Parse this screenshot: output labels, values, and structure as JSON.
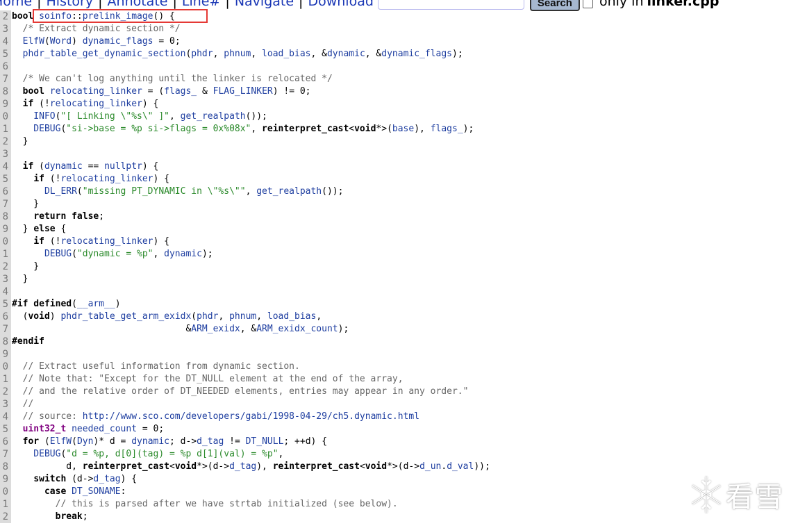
{
  "nav": {
    "links": [
      "Home",
      "History",
      "Annotate",
      "Line#",
      "Navigate",
      "Download"
    ],
    "search_value": "",
    "search_button": "Search",
    "only_in_label": "only in",
    "only_in_file": "linker.cpp",
    "only_in_checked": false
  },
  "highlight": {
    "color": "#e53935",
    "target": "soinfo::prelink_image() {"
  },
  "code_lines": [
    {
      "n": "2",
      "tokens": [
        [
          "k",
          "bool"
        ],
        [
          "",
          ""
        ],
        [
          "i",
          " soinfo"
        ],
        [
          "",
          "::"
        ],
        [
          "i",
          "prelink_image"
        ],
        [
          "",
          "() {"
        ]
      ]
    },
    {
      "n": "3",
      "tokens": [
        [
          "c",
          "  /* Extract dynamic section */"
        ]
      ]
    },
    {
      "n": "4",
      "tokens": [
        [
          "i",
          "  ElfW"
        ],
        [
          "",
          "("
        ],
        [
          "i",
          "Word"
        ],
        [
          "",
          ") "
        ],
        [
          "i",
          "dynamic_flags"
        ],
        [
          "",
          " = 0;"
        ]
      ]
    },
    {
      "n": "5",
      "tokens": [
        [
          "i",
          "  phdr_table_get_dynamic_section"
        ],
        [
          "",
          "("
        ],
        [
          "i",
          "phdr"
        ],
        [
          "",
          ", "
        ],
        [
          "i",
          "phnum"
        ],
        [
          "",
          ", "
        ],
        [
          "i",
          "load_bias"
        ],
        [
          "",
          ", &"
        ],
        [
          "i",
          "dynamic"
        ],
        [
          "",
          ", &"
        ],
        [
          "i",
          "dynamic_flags"
        ],
        [
          "",
          ");"
        ]
      ]
    },
    {
      "n": "6",
      "tokens": []
    },
    {
      "n": "7",
      "tokens": [
        [
          "c",
          "  /* We can't log anything until the linker is relocated */"
        ]
      ]
    },
    {
      "n": "8",
      "tokens": [
        [
          "",
          "  "
        ],
        [
          "k",
          "bool"
        ],
        [
          "i",
          " relocating_linker"
        ],
        [
          "",
          " = ("
        ],
        [
          "i",
          "flags_"
        ],
        [
          "",
          " & "
        ],
        [
          "i",
          "FLAG_LINKER"
        ],
        [
          "",
          ") != 0;"
        ]
      ]
    },
    {
      "n": "9",
      "tokens": [
        [
          "",
          "  "
        ],
        [
          "k",
          "if"
        ],
        [
          "",
          " (!"
        ],
        [
          "i",
          "relocating_linker"
        ],
        [
          "",
          ") {"
        ]
      ]
    },
    {
      "n": "0",
      "tokens": [
        [
          "i",
          "    INFO"
        ],
        [
          "",
          "("
        ],
        [
          "s",
          "\"[ Linking \\\"%s\\\" ]\""
        ],
        [
          "",
          ", "
        ],
        [
          "i",
          "get_realpath"
        ],
        [
          "",
          "());"
        ]
      ]
    },
    {
      "n": "1",
      "tokens": [
        [
          "i",
          "    DEBUG"
        ],
        [
          "",
          "("
        ],
        [
          "s",
          "\"si->base = %p si->flags = 0x%08x\""
        ],
        [
          "",
          ", "
        ],
        [
          "k",
          "reinterpret_cast"
        ],
        [
          "",
          "<"
        ],
        [
          "k",
          "void"
        ],
        [
          "",
          "*>("
        ],
        [
          "i",
          "base"
        ],
        [
          "",
          "), "
        ],
        [
          "i",
          "flags_"
        ],
        [
          "",
          ");"
        ]
      ]
    },
    {
      "n": "2",
      "tokens": [
        [
          "",
          "  }"
        ]
      ]
    },
    {
      "n": "3",
      "tokens": []
    },
    {
      "n": "4",
      "tokens": [
        [
          "",
          "  "
        ],
        [
          "k",
          "if"
        ],
        [
          "",
          " ("
        ],
        [
          "i",
          "dynamic"
        ],
        [
          "",
          " == "
        ],
        [
          "i",
          "nullptr"
        ],
        [
          "",
          ") {"
        ]
      ]
    },
    {
      "n": "5",
      "tokens": [
        [
          "",
          "    "
        ],
        [
          "k",
          "if"
        ],
        [
          "",
          " (!"
        ],
        [
          "i",
          "relocating_linker"
        ],
        [
          "",
          ") {"
        ]
      ]
    },
    {
      "n": "6",
      "tokens": [
        [
          "i",
          "      DL_ERR"
        ],
        [
          "",
          "("
        ],
        [
          "s",
          "\"missing PT_DYNAMIC in \\\"%s\\\"\""
        ],
        [
          "",
          ", "
        ],
        [
          "i",
          "get_realpath"
        ],
        [
          "",
          "());"
        ]
      ]
    },
    {
      "n": "7",
      "tokens": [
        [
          "",
          "    }"
        ]
      ]
    },
    {
      "n": "8",
      "tokens": [
        [
          "",
          "    "
        ],
        [
          "k",
          "return"
        ],
        [
          "",
          " "
        ],
        [
          "k",
          "false"
        ],
        [
          "",
          ";"
        ]
      ]
    },
    {
      "n": "9",
      "tokens": [
        [
          "",
          "  } "
        ],
        [
          "k",
          "else"
        ],
        [
          "",
          " {"
        ]
      ]
    },
    {
      "n": "0",
      "tokens": [
        [
          "",
          "    "
        ],
        [
          "k",
          "if"
        ],
        [
          "",
          " (!"
        ],
        [
          "i",
          "relocating_linker"
        ],
        [
          "",
          ") {"
        ]
      ]
    },
    {
      "n": "1",
      "tokens": [
        [
          "i",
          "      DEBUG"
        ],
        [
          "",
          "("
        ],
        [
          "s",
          "\"dynamic = %p\""
        ],
        [
          "",
          ", "
        ],
        [
          "i",
          "dynamic"
        ],
        [
          "",
          ");"
        ]
      ]
    },
    {
      "n": "2",
      "tokens": [
        [
          "",
          "    }"
        ]
      ]
    },
    {
      "n": "3",
      "tokens": [
        [
          "",
          "  }"
        ]
      ]
    },
    {
      "n": "4",
      "tokens": []
    },
    {
      "n": "5",
      "tokens": [
        [
          "k",
          "#if defined"
        ],
        [
          "",
          "("
        ],
        [
          "i",
          "__arm__"
        ],
        [
          "",
          ")"
        ]
      ]
    },
    {
      "n": "6",
      "tokens": [
        [
          "",
          "  ("
        ],
        [
          "k",
          "void"
        ],
        [
          "",
          ") "
        ],
        [
          "i",
          "phdr_table_get_arm_exidx"
        ],
        [
          "",
          "("
        ],
        [
          "i",
          "phdr"
        ],
        [
          "",
          ", "
        ],
        [
          "i",
          "phnum"
        ],
        [
          "",
          ", "
        ],
        [
          "i",
          "load_bias"
        ],
        [
          "",
          ","
        ]
      ]
    },
    {
      "n": "7",
      "tokens": [
        [
          "",
          "                                &"
        ],
        [
          "i",
          "ARM_exidx"
        ],
        [
          "",
          ", &"
        ],
        [
          "i",
          "ARM_exidx_count"
        ],
        [
          "",
          ");"
        ]
      ]
    },
    {
      "n": "8",
      "tokens": [
        [
          "k",
          "#endif"
        ]
      ]
    },
    {
      "n": "9",
      "tokens": []
    },
    {
      "n": "0",
      "tokens": [
        [
          "c",
          "  // Extract useful information from dynamic section."
        ]
      ]
    },
    {
      "n": "1",
      "tokens": [
        [
          "c",
          "  // Note that: \"Except for the DT_NULL element at the end of the array,"
        ]
      ]
    },
    {
      "n": "2",
      "tokens": [
        [
          "c",
          "  // and the relative order of DT_NEEDED elements, entries may appear in any order.\""
        ]
      ]
    },
    {
      "n": "3",
      "tokens": [
        [
          "c",
          "  //"
        ]
      ]
    },
    {
      "n": "4",
      "tokens": [
        [
          "c",
          "  // source: "
        ],
        [
          "u",
          "http://www.sco.com/developers/gabi/1998-04-29/ch5.dynamic.html"
        ]
      ]
    },
    {
      "n": "5",
      "tokens": [
        [
          "",
          "  "
        ],
        [
          "t",
          "uint32_t"
        ],
        [
          "i",
          " needed_count"
        ],
        [
          "",
          " = 0;"
        ]
      ]
    },
    {
      "n": "6",
      "tokens": [
        [
          "",
          "  "
        ],
        [
          "k",
          "for"
        ],
        [
          "",
          " ("
        ],
        [
          "i",
          "ElfW"
        ],
        [
          "",
          "("
        ],
        [
          "i",
          "Dyn"
        ],
        [
          "",
          ")* d = "
        ],
        [
          "i",
          "dynamic"
        ],
        [
          "",
          "; d->"
        ],
        [
          "i",
          "d_tag"
        ],
        [
          "",
          " != "
        ],
        [
          "i",
          "DT_NULL"
        ],
        [
          "",
          "; ++d) {"
        ]
      ]
    },
    {
      "n": "7",
      "tokens": [
        [
          "i",
          "    DEBUG"
        ],
        [
          "",
          "("
        ],
        [
          "s",
          "\"d = %p, d[0](tag) = %p d[1](val) = %p\""
        ],
        [
          "",
          ","
        ]
      ]
    },
    {
      "n": "8",
      "tokens": [
        [
          "",
          "          d, "
        ],
        [
          "k",
          "reinterpret_cast"
        ],
        [
          "",
          "<"
        ],
        [
          "k",
          "void"
        ],
        [
          "",
          "*>(d->"
        ],
        [
          "i",
          "d_tag"
        ],
        [
          "",
          "), "
        ],
        [
          "k",
          "reinterpret_cast"
        ],
        [
          "",
          "<"
        ],
        [
          "k",
          "void"
        ],
        [
          "",
          "*>(d->"
        ],
        [
          "i",
          "d_un"
        ],
        [
          "",
          "."
        ],
        [
          "i",
          "d_val"
        ],
        [
          "",
          "));"
        ]
      ]
    },
    {
      "n": "9",
      "tokens": [
        [
          "",
          "    "
        ],
        [
          "k",
          "switch"
        ],
        [
          "",
          " (d->"
        ],
        [
          "i",
          "d_tag"
        ],
        [
          "",
          ") {"
        ]
      ]
    },
    {
      "n": "0",
      "tokens": [
        [
          "",
          "      "
        ],
        [
          "k",
          "case"
        ],
        [
          "i",
          " DT_SONAME"
        ],
        [
          "",
          ":"
        ]
      ]
    },
    {
      "n": "1",
      "tokens": [
        [
          "c",
          "        // this is parsed after we have strtab initialized (see below)."
        ]
      ]
    },
    {
      "n": "2",
      "tokens": [
        [
          "",
          "        "
        ],
        [
          "k",
          "break"
        ],
        [
          "",
          ";"
        ]
      ]
    }
  ],
  "watermark": {
    "icon": "snowflake-icon",
    "text": "看雪"
  }
}
